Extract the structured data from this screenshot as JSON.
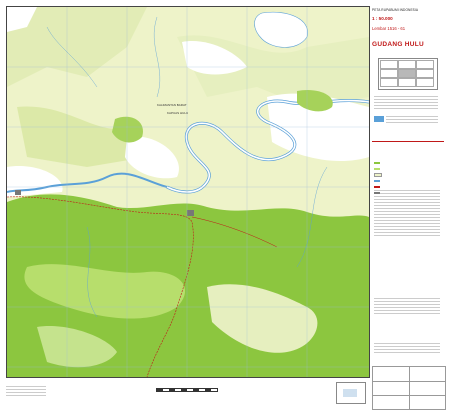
{
  "header": {
    "country": "PETA RUPABUMI INDONESIA",
    "scale": "1 : 50.000",
    "sheet_number": "Lembar 1516 - 61",
    "sheet_name": "GUDANG HULU"
  },
  "map": {
    "labels": {
      "province": "KALIMANTAN BARAT",
      "district": "KAPUAS HULU"
    }
  },
  "colors": {
    "forest": "#8cc63f",
    "forest_light": "#b7de6c",
    "background": "#eef3c9",
    "water": "#ffffff",
    "river_outline": "#5aa0d8",
    "red_text": "#c01818"
  }
}
